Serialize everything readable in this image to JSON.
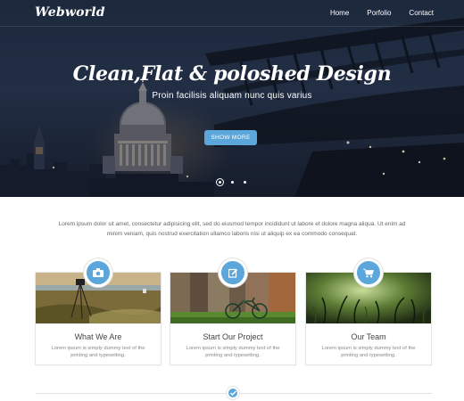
{
  "header": {
    "logo": "Webworld",
    "nav": [
      "Home",
      "Porfolio",
      "Contact"
    ]
  },
  "hero": {
    "title": "Clean,Flat & poloshed Design",
    "subtitle": "Proin facilisis aliquam nunc quis varius",
    "button_label": "SHOW MORE",
    "slides_total": 3,
    "active_slide": 1
  },
  "intro": {
    "text": "Lorem ipsum dolor sit amet, consectetur adipisicing elit, sed do eiusmod tempor incididunt ut labore et dolore magna aliqua. Ut enim ad minim veniam, quis nostrud exercitation ullamco laboris nisi ut aliquip ex ea commodo consequat."
  },
  "features": [
    {
      "icon": "camera-icon",
      "title": "What We Are",
      "text": "Lorem ipsum is simply dummy text of the printing and typesetting."
    },
    {
      "icon": "edit-icon",
      "title": "Start Our Project",
      "text": "Lorem ipsum is simply dummy text of the printing and typesetting."
    },
    {
      "icon": "cart-icon",
      "title": "Our Team",
      "text": "Lorem ipsum is simply dummy text of the printing and typesetting."
    }
  ],
  "divider": {
    "icon": "check-icon"
  },
  "colors": {
    "accent": "#5ba7db",
    "hero_bg": "#1d2a3f",
    "text": "#555555"
  }
}
